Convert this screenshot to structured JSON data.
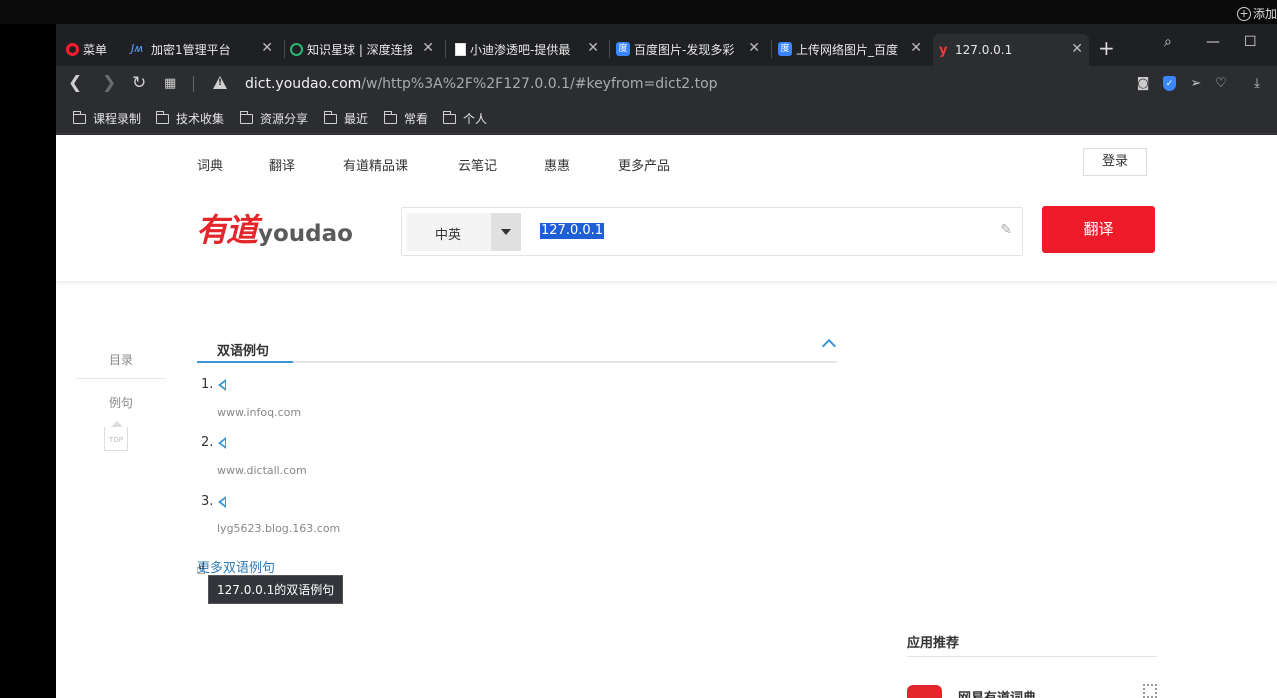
{
  "desktop": {
    "add_widget": "添加"
  },
  "tabs": [
    {
      "label": "菜单",
      "icon": "opera-icon"
    },
    {
      "label": "加密1管理平台",
      "icon": "jm-icon"
    },
    {
      "label": "知识星球 | 深度连接",
      "icon": "zsxq-icon"
    },
    {
      "label": "小迪渗透吧-提供最",
      "icon": "document-icon"
    },
    {
      "label": "百度图片-发现多彩",
      "icon": "baidu-icon"
    },
    {
      "label": "上传网络图片_百度",
      "icon": "baidu-icon"
    },
    {
      "label": "127.0.0.1",
      "icon": "youdao-icon",
      "active": true
    }
  ],
  "address": {
    "url_host": "dict.youdao.com",
    "url_path": "/w/http%3A%2F%2F127.0.0.1/#keyfrom=dict2.top"
  },
  "bookmarks": [
    "课程录制",
    "技术收集",
    "资源分享",
    "最近",
    "常看",
    "个人"
  ],
  "header": {
    "nav": [
      "词典",
      "翻译",
      "有道精品课",
      "云笔记",
      "惠惠",
      "更多产品"
    ],
    "login": "登录",
    "logo_cn": "有道",
    "logo_en": "youdao",
    "lang": "中英",
    "query": "127.0.0.1",
    "translate": "翻译"
  },
  "sidebar": {
    "toc": "目录",
    "examples": "例句",
    "top": "TOP"
  },
  "content": {
    "section_title": "双语例句",
    "examples": [
      {
        "num": "1.",
        "source": "www.infoq.com"
      },
      {
        "num": "2.",
        "source": "www.dictall.com"
      },
      {
        "num": "3.",
        "source": "lyg5623.blog.163.com"
      }
    ],
    "more_link": "更多双语例句",
    "tooltip": "127.0.0.1的双语例句"
  },
  "apps": {
    "title": "应用推荐",
    "first": "网易有道词典"
  },
  "colors": {
    "accent": "#3a97d3",
    "brand_red": "#ee1c2b"
  }
}
